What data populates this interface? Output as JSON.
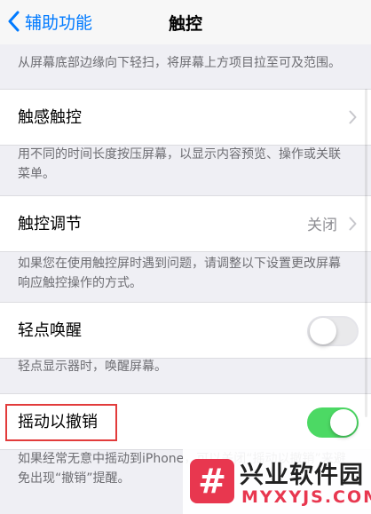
{
  "nav": {
    "back_label": "辅助功能",
    "title": "触控"
  },
  "footnote_top": "从屏幕底部边缘向下轻扫，将屏幕上方项目拉至可及范围。",
  "rows": [
    {
      "label": "触感触控",
      "value": "",
      "control": "chevron",
      "footnote": "用不同的时间长度按压屏幕，以显示内容预览、操作或关联菜单。"
    },
    {
      "label": "触控调节",
      "value": "关闭",
      "control": "chevron",
      "footnote": "如果您在使用触控屏时遇到问题，请调整以下设置更改屏幕响应触控操作的方式。"
    },
    {
      "label": "轻点唤醒",
      "value": "",
      "control": "switch-off",
      "footnote": "轻点显示器时，唤醒屏幕。"
    },
    {
      "label": "摇动以撤销",
      "value": "",
      "control": "switch-on",
      "footnote": "如果经常无意中摇动到iPhone，可以关闭“摇动以撤销”来避免出现“撤销”提醒。"
    }
  ],
  "colors": {
    "accent": "#007aff",
    "switch_on": "#4cd964",
    "highlight": "#e23b3b",
    "watermark": "#e8374f"
  },
  "watermark": {
    "logo_glyph": "#",
    "name_cn": "兴业软件园",
    "name_en": "MYXYJS.COM"
  }
}
